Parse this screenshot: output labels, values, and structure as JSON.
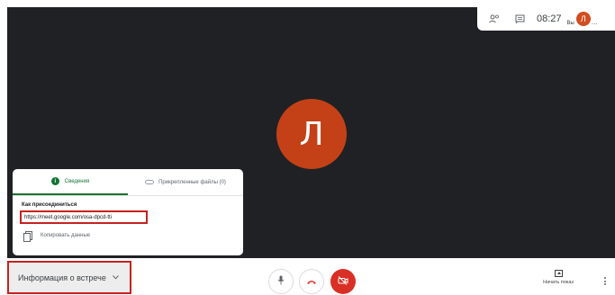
{
  "topbar": {
    "time": "08:27",
    "you_label": "Вы",
    "avatar_letter": "Л",
    "more_label": "..."
  },
  "main": {
    "avatar_letter": "Л"
  },
  "info_panel": {
    "tabs": [
      {
        "label": "Сведения"
      },
      {
        "label": "Прикрепленные файлы (0)"
      }
    ],
    "active_tab_icon_glyph": "i",
    "join_label": "Как присоединиться",
    "meeting_link": "https://meet.google.com/osa-dpcd-tti",
    "copy_label": "Копировать данные"
  },
  "bottombar": {
    "meeting_info_label": "Информация о встрече",
    "present_label": "Начать показ"
  },
  "colors": {
    "stage_bg": "#202124",
    "avatar": "#c44118",
    "active_tab": "#137333",
    "highlight": "#c5221f",
    "camera_off": "#d93025"
  },
  "icons": [
    "participants-icon",
    "chat-icon",
    "info-icon",
    "attachment-icon",
    "copy-icon",
    "chevron-down-icon",
    "mic-icon",
    "hang-up-icon",
    "camera-off-icon",
    "present-screen-icon",
    "more-vert-icon"
  ]
}
